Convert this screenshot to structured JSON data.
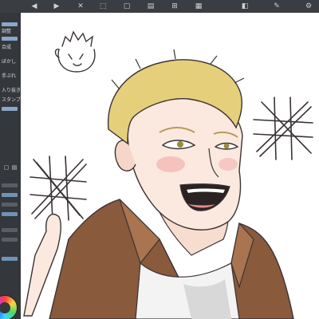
{
  "toolbar": {
    "icons": [
      "undo-icon",
      "redo-icon",
      "clear-icon",
      "transform-icon",
      "deselect-icon",
      "ruler-icon",
      "snap-icon",
      "grid-icon",
      "layer-icon",
      "tools-icon",
      "settings-icon"
    ]
  },
  "left_panel": {
    "labels": [
      "調整",
      "合成",
      "ぼかし",
      "手ぶれ",
      "入り抜き",
      "スタンプ"
    ],
    "brush_colors": [
      "#8aa7c9",
      "#8aa7c9",
      "#8aa7c9"
    ]
  },
  "canvas": {
    "background": "#ffffff",
    "line_color": "#3a3335",
    "hair_color": "#e6cf7a",
    "skin_color": "#fbe9df",
    "jacket_color": "#8a5a3c",
    "shirt_color": "#f3f3f3"
  }
}
